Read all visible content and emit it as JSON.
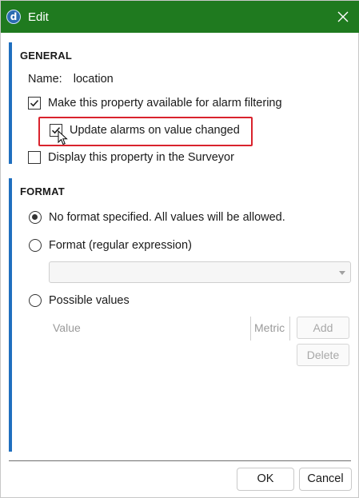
{
  "window": {
    "title": "Edit",
    "app_icon_letter": "d",
    "accent_color": "#1f7a1f",
    "section_bar_color": "#1f6fbf",
    "highlight_color": "#d9232d"
  },
  "general": {
    "title": "GENERAL",
    "name_label": "Name:",
    "name_value": "location",
    "alarm_filtering_label": "Make this property available for alarm filtering",
    "alarm_filtering_checked": true,
    "update_alarms_label": "Update alarms on value changed",
    "update_alarms_checked": true,
    "surveyor_label": "Display this property in the Surveyor",
    "surveyor_checked": false
  },
  "format": {
    "title": "FORMAT",
    "options": [
      {
        "label": "No format specified. All values will be allowed.",
        "selected": true
      },
      {
        "label": "Format (regular expression)",
        "selected": false
      },
      {
        "label": "Possible values",
        "selected": false
      }
    ],
    "regex_value": "",
    "columns": [
      "Value",
      "Metric"
    ],
    "add_label": "Add",
    "delete_label": "Delete"
  },
  "footer": {
    "ok_label": "OK",
    "cancel_label": "Cancel"
  }
}
